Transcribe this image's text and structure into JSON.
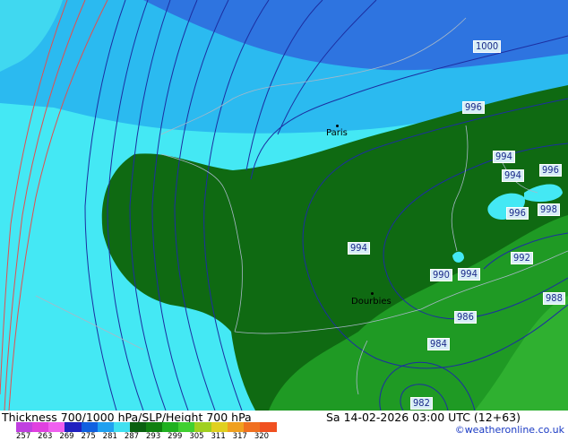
{
  "map": {
    "pressure_labels": [
      "1000",
      "996",
      "994",
      "994",
      "996",
      "996",
      "998",
      "994",
      "992",
      "990",
      "994",
      "988",
      "986",
      "984",
      "982"
    ],
    "cities": [
      {
        "name": "Paris"
      },
      {
        "name": "Dourbies"
      }
    ],
    "colors": {
      "land": "#0f6a12",
      "sea_light": "#44e8f4",
      "sea_mid": "#2bbaf0",
      "sea_deep": "#2e74e0",
      "land_green": "#1f9a24",
      "isobar": "#1c2ea0",
      "thickness_line": "#e05050",
      "border": "#a8b8c8"
    }
  },
  "footer": {
    "title": "Thickness 700/1000 hPa/SLP/Height 700 hPa",
    "datetime": "Sa 14-02-2026 03:00 UTC (12+63)",
    "credit": "©weatheronline.co.uk",
    "scale_ticks": [
      "257",
      "263",
      "269",
      "275",
      "281",
      "287",
      "293",
      "299",
      "305",
      "311",
      "317",
      "320"
    ],
    "scale_colors": [
      "#c040e0",
      "#e040e0",
      "#f060f0",
      "#2020c0",
      "#1060e0",
      "#20a0f0",
      "#40e0f0",
      "#0a6010",
      "#108010",
      "#20b020",
      "#40d030",
      "#a0d020",
      "#e0d020",
      "#f0a020",
      "#f07020",
      "#f05020"
    ]
  }
}
